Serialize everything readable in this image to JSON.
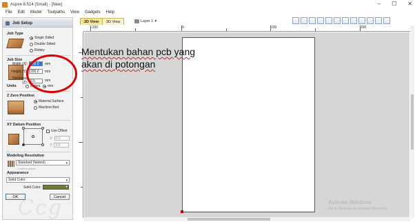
{
  "window": {
    "title": "Aspire 8.514 (Small) - [New]",
    "minimize": "–",
    "maximize": "☐",
    "close": "✕"
  },
  "menu": [
    "File",
    "Edit",
    "Model",
    "Toolpaths",
    "View",
    "Gadgets",
    "Help"
  ],
  "panel": {
    "header": "Job Setup",
    "job_type": {
      "title": "Job Type",
      "options": [
        "Single Sided",
        "Double Sided",
        "Rotary"
      ],
      "selected": "Single Sided"
    },
    "job_size": {
      "title": "Job Size",
      "width_label": "Width (X):",
      "width_value": "100.0",
      "height_label": "Height (Y):",
      "height_value": "200.0",
      "thickness_label": "Thickness (Z):",
      "thickness_value": "0.5",
      "unit": "mm"
    },
    "units": {
      "title": "Units",
      "options": [
        "inches",
        "mm"
      ],
      "selected": "mm"
    },
    "z_zero": {
      "title": "Z Zero Position",
      "options": [
        "Material Surface",
        "Machine Bed"
      ],
      "selected": "Material Surface"
    },
    "xy_datum": {
      "title": "XY Datum Position",
      "use_offset": "Use Offset",
      "x_label": "X:",
      "x_value": "0.0",
      "y_label": "Y:",
      "y_value": "0.0"
    },
    "modeling": {
      "title": "Modeling Resolution",
      "value": "Standard (fastest)",
      "hint": "1 million points"
    },
    "appearance": {
      "title": "Appearance",
      "value": "Solid Color",
      "color_label": "Solid Color:",
      "color": "#7a7a20"
    },
    "ok": "OK",
    "cancel": "Cancel"
  },
  "view": {
    "tab_2d": "2D View",
    "tab_3d": "3D View",
    "layer": "Layer 1"
  },
  "ruler": {
    "top_labels": [
      "-100",
      "0",
      "100",
      "200"
    ],
    "left_labels": [
      "0",
      "100",
      "200"
    ]
  },
  "annotation": {
    "line1": "Mentukan bahan pcb yang",
    "line2": "akan di potongan"
  },
  "watermark": {
    "line1": "Activate Windows",
    "line2": "Go to Settings to activate Windows."
  }
}
